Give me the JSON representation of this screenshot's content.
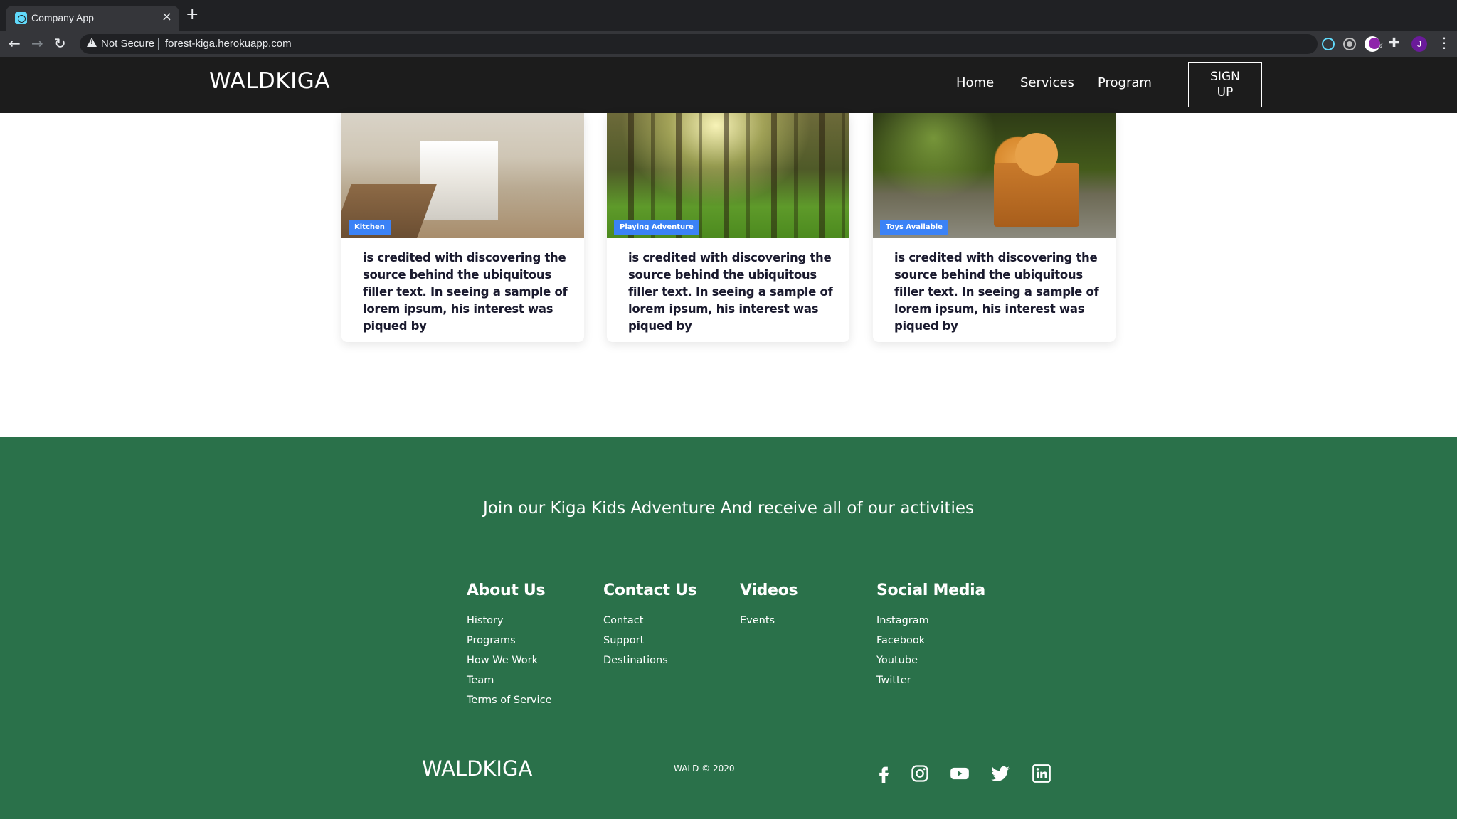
{
  "browser": {
    "tab_title": "Company App",
    "tab_close": "×",
    "new_tab": "+",
    "security_label": "Not Secure",
    "url": "forest-kiga.herokuapp.com",
    "profile_initial": "J"
  },
  "header": {
    "logo": "WALDKIGA",
    "nav": [
      "Home",
      "Services",
      "Program"
    ],
    "signup_line1": "SIGN",
    "signup_line2": "UP"
  },
  "cards": [
    {
      "tag": "Kitchen",
      "image": "kitchen-photo",
      "text": "is credited with discovering the source behind the ubiquitous filler text. In seeing a sample of lorem ipsum, his interest was piqued by"
    },
    {
      "tag": "Playing Adventure",
      "image": "forest-photo",
      "text": "is credited with discovering the source behind the ubiquitous filler text. In seeing a sample of lorem ipsum, his interest was piqued by"
    },
    {
      "tag": "Toys Available",
      "image": "teddy-bear-photo",
      "text": "is credited with discovering the source behind the ubiquitous filler text. In seeing a sample of lorem ipsum, his interest was piqued by"
    }
  ],
  "footer": {
    "newsletter": "Join our Kiga Kids Adventure And receive all of our activities",
    "columns": [
      {
        "title": "About Us",
        "links": [
          "History",
          "Programs",
          "How We Work",
          "Team",
          "Terms of Service"
        ]
      },
      {
        "title": "Contact Us",
        "links": [
          "Contact",
          "Support",
          "Destinations"
        ]
      },
      {
        "title": "Videos",
        "links": [
          "Events"
        ]
      },
      {
        "title": "Social Media",
        "links": [
          "Instagram",
          "Facebook",
          "Youtube",
          "Twitter"
        ]
      }
    ],
    "logo": "WALDKIGA",
    "copyright": "WALD © 2020",
    "social_icons": [
      "facebook-icon",
      "instagram-icon",
      "youtube-icon",
      "twitter-icon",
      "linkedin-icon"
    ]
  },
  "colors": {
    "header_bg": "#1c1c1c",
    "footer_bg": "#2a714a",
    "tag_bg": "#3b82f6",
    "card_text": "#1a1a2e"
  }
}
